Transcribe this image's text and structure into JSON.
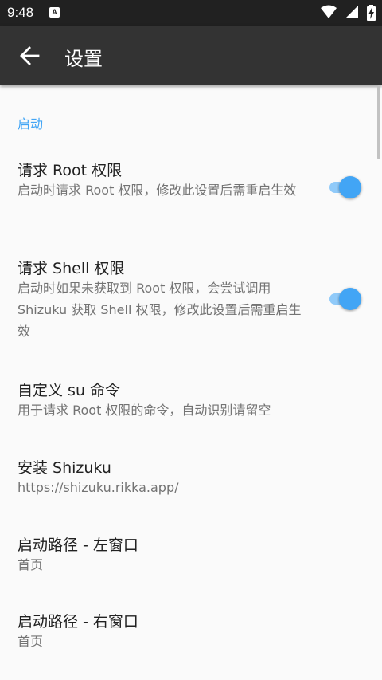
{
  "status_bar": {
    "time": "9:48",
    "notification_icon": "A",
    "icons": [
      "wifi-icon",
      "signal-icon",
      "battery-charging-icon"
    ]
  },
  "app_bar": {
    "back_icon": "arrow-left-icon",
    "title": "设置"
  },
  "section": {
    "header": "启动"
  },
  "items": [
    {
      "title": "请求 Root 权限",
      "summary": "启动时请求 Root 权限，修改此设置后需重启生效",
      "toggle": true
    },
    {
      "title": "请求 Shell 权限",
      "summary": "启动时如果未获取到 Root 权限，会尝试调用 Shizuku 获取 Shell 权限，修改此设置后需重启生效",
      "toggle": true
    },
    {
      "title": "自定义 su 命令",
      "summary": "用于请求 Root 权限的命令，自动识别请留空"
    },
    {
      "title": "安装 Shizuku",
      "summary": "https://shizuku.rikka.app/"
    },
    {
      "title": "启动路径 - 左窗口",
      "summary": "首页"
    },
    {
      "title": "启动路径 - 右窗口",
      "summary": "首页"
    }
  ],
  "colors": {
    "accent": "#42a5f5",
    "app_bar": "#333333",
    "status_bar": "#212121",
    "background": "#fafafa"
  }
}
